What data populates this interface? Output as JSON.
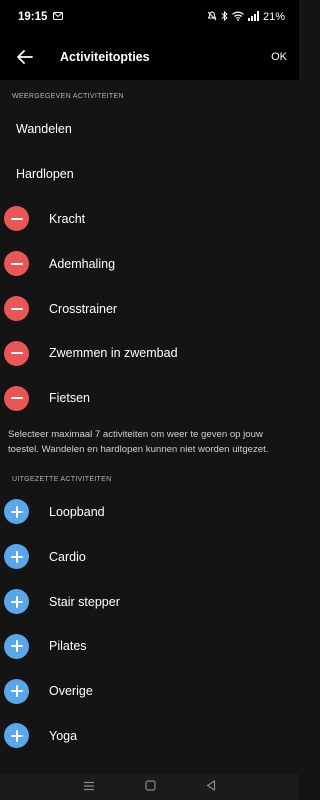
{
  "status": {
    "time": "19:15",
    "battery": "21%"
  },
  "header": {
    "title": "Activiteitopties",
    "ok_label": "OK"
  },
  "displayed": {
    "heading": "WEERGEGEVEN ACTIVITEITEN",
    "fixed_items": [
      {
        "label": "Wandelen"
      },
      {
        "label": "Hardlopen"
      }
    ],
    "removable_items": [
      {
        "label": "Kracht"
      },
      {
        "label": "Ademhaling"
      },
      {
        "label": "Crosstrainer"
      },
      {
        "label": "Zwemmen in zwembad"
      },
      {
        "label": "Fietsen"
      }
    ]
  },
  "note": "Selecteer maximaal 7 activiteiten om weer te geven op jouw toestel. Wandelen en hardlopen kunnen niet worden uitgezet.",
  "disabled": {
    "heading": "UITGEZETTE ACTIVITEITEN",
    "items": [
      {
        "label": "Loopband"
      },
      {
        "label": "Cardio"
      },
      {
        "label": "Stair stepper"
      },
      {
        "label": "Pilates"
      },
      {
        "label": "Overige"
      },
      {
        "label": "Yoga"
      }
    ]
  },
  "colors": {
    "remove": "#e85656",
    "add": "#5aa6eb",
    "background": "#141414"
  },
  "icons": [
    "back-arrow-icon",
    "minus-icon",
    "plus-icon",
    "wifi-icon",
    "signal-icon",
    "battery-icon",
    "bluetooth-icon",
    "mute-icon",
    "message-icon"
  ]
}
